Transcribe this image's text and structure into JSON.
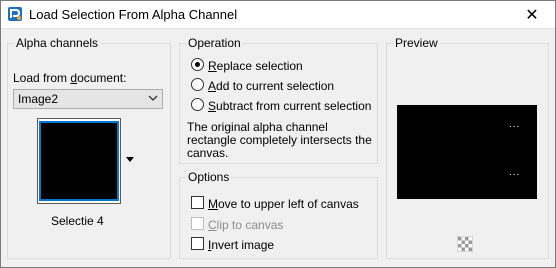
{
  "window": {
    "title": "Load Selection From Alpha Channel",
    "close_glyph": "✕"
  },
  "alpha_channels": {
    "group_label": "Alpha channels",
    "load_from_label_pre": "Load from ",
    "load_from_label_u": "d",
    "load_from_label_post": "ocument:",
    "document_selected": "Image2",
    "channel_name": "Selectie 4"
  },
  "operation": {
    "group_label": "Operation",
    "options": [
      {
        "u": "R",
        "rest": "eplace selection",
        "checked": true
      },
      {
        "u": "A",
        "rest": "dd to current selection",
        "checked": false
      },
      {
        "u": "S",
        "rest": "ubtract from current selection",
        "checked": false
      }
    ],
    "info_lines": [
      "The original alpha channel",
      "rectangle completely intersects the",
      "canvas."
    ]
  },
  "options": {
    "group_label": "Options",
    "items": [
      {
        "u": "M",
        "rest": "ove to upper left of canvas",
        "checked": false,
        "disabled": false
      },
      {
        "u": "C",
        "rest": "lip to canvas",
        "checked": false,
        "disabled": true
      },
      {
        "u": "I",
        "rest": "nvert image",
        "checked": false,
        "disabled": false
      }
    ]
  },
  "preview": {
    "group_label": "Preview",
    "dots_top": "...",
    "dots_bottom": "..."
  },
  "icons": {
    "app": "paint-shop-pro-icon",
    "close": "close-icon",
    "dropdown": "chevron-down-icon",
    "thumb_dropdown": "triangle-down-icon",
    "preview_toggle": "checkerboard-icon"
  }
}
